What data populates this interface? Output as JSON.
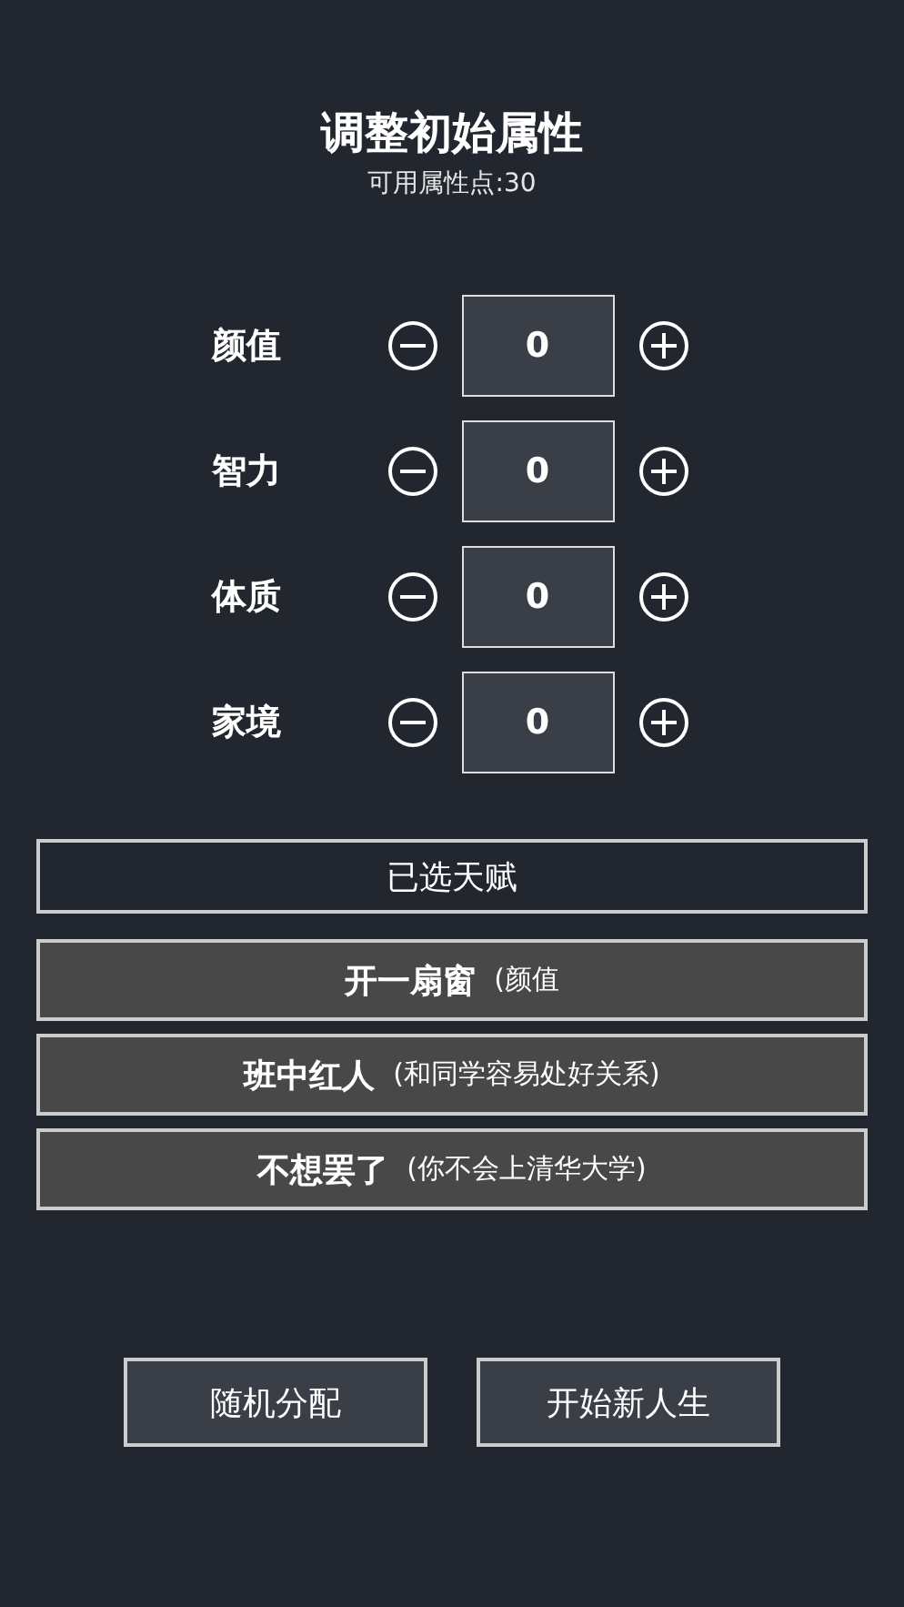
{
  "title": "调整初始属性",
  "points": "可用属性点:30",
  "attributes": [
    {
      "name": "颜值",
      "value": "0"
    },
    {
      "name": "智力",
      "value": "0"
    },
    {
      "name": "体质",
      "value": "0"
    },
    {
      "name": "家境",
      "value": "0"
    }
  ],
  "talents_header": "已选天赋",
  "talents": [
    {
      "name": "开一扇窗",
      "description": "(颜值"
    },
    {
      "name": "班中红人",
      "description": "(和同学容易处好关系)"
    },
    {
      "name": "不想罢了",
      "description": "(你不会上清华大学)"
    }
  ],
  "buttons": [
    "随机分配",
    "开始新人生"
  ]
}
